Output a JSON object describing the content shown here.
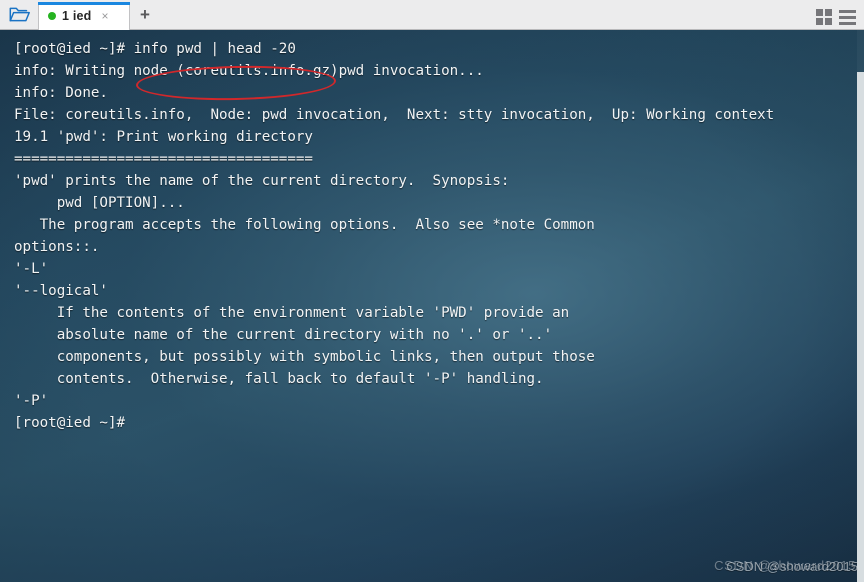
{
  "window": {
    "title": "1 ied"
  },
  "tabbar": {
    "folder_icon": "folder-open-icon",
    "tabs": [
      {
        "label": "1 ied",
        "status_dot_color": "#25b321",
        "close_label": "×",
        "active": true
      }
    ],
    "add_tab_label": "+",
    "right_icons": [
      {
        "name": "grid-view-icon"
      },
      {
        "name": "hamburger-menu-icon"
      }
    ]
  },
  "terminal": {
    "background_color": "#27506a",
    "text_color": "#f2f4f5",
    "prompt": "[root@ied ~]#",
    "lines": [
      "[root@ied ~]# info pwd | head -20",
      "info: Writing node (coreutils.info.gz)pwd invocation...",
      "info: Done.",
      "File: coreutils.info,  Node: pwd invocation,  Next: stty invocation,  Up: Working context",
      "",
      "19.1 'pwd': Print working directory",
      "===================================",
      "",
      "'pwd' prints the name of the current directory.  Synopsis:",
      "",
      "     pwd [OPTION]...",
      "",
      "   The program accepts the following options.  Also see *note Common",
      "options::.",
      "",
      "'-L'",
      "'--logical'",
      "     If the contents of the environment variable 'PWD' provide an",
      "     absolute name of the current directory with no '.' or '..'",
      "     components, but possibly with symbolic links, then output those",
      "     contents.  Otherwise, fall back to default '-P' handling.",
      "",
      "'-P'",
      "[root@ied ~]#"
    ]
  },
  "annotation": {
    "type": "ellipse",
    "color": "#d1282b",
    "targets_text": "info pwd | head -20"
  },
  "scrollbar": {
    "orientation": "vertical",
    "thumb_color": "#d7dde0"
  },
  "watermark": {
    "primary": "CSDN @showard2015",
    "secondary": "CSDN @showard2015"
  }
}
